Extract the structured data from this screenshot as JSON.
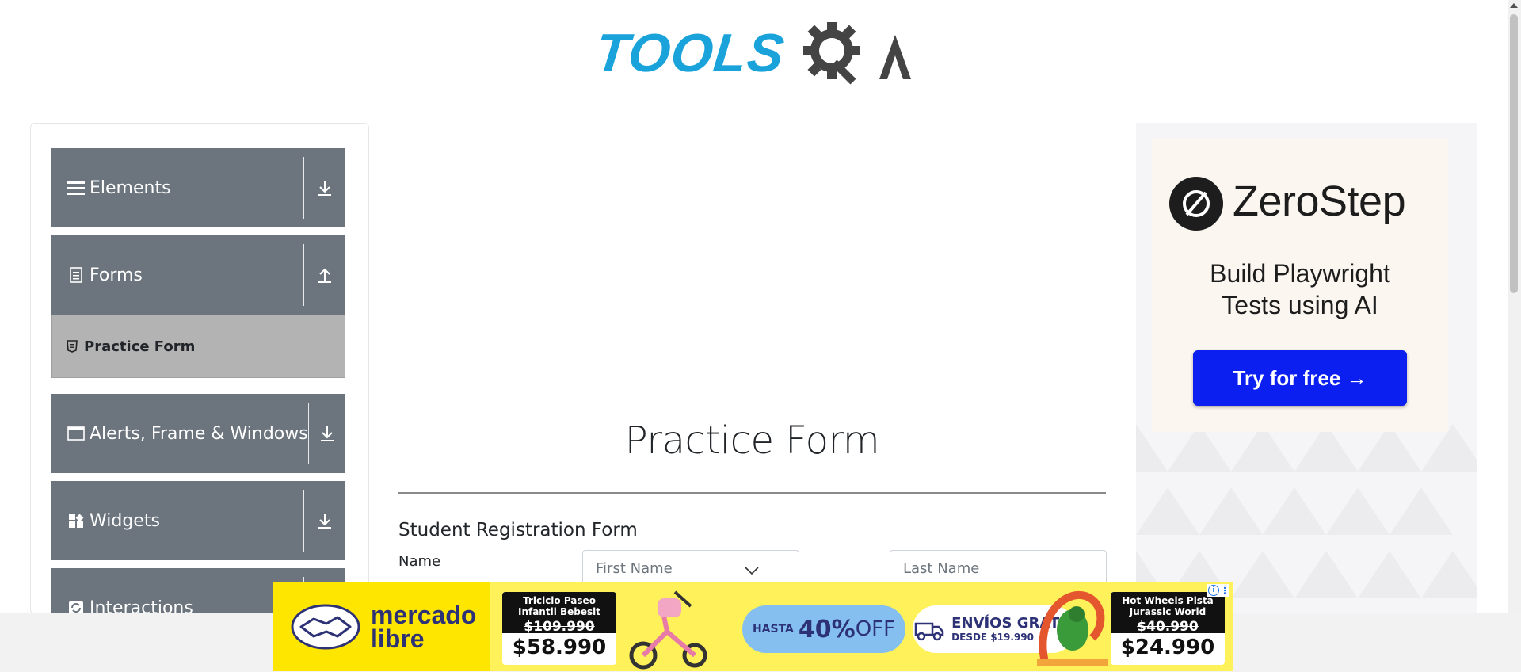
{
  "logo": {
    "part1": "TOOLS",
    "part2": "QA"
  },
  "sidebar": {
    "groups": [
      {
        "label": "Elements",
        "icon": "hamburger-icon",
        "toggle": "download-arrow-icon"
      },
      {
        "label": "Forms",
        "icon": "document-icon",
        "toggle": "upload-arrow-icon"
      },
      {
        "label": "Alerts, Frame & Windows",
        "icon": "window-icon",
        "toggle": "download-arrow-icon"
      },
      {
        "label": "Widgets",
        "icon": "widgets-icon",
        "toggle": "download-arrow-icon"
      },
      {
        "label": "Interactions",
        "icon": "refresh-icon",
        "toggle": "download-arrow-icon"
      }
    ],
    "active_item": {
      "label": "Practice Form",
      "icon": "html5-icon"
    }
  },
  "main": {
    "page_title": "Practice Form",
    "form_title": "Student Registration Form",
    "name_label": "Name",
    "first_name_placeholder": "First Name",
    "last_name_placeholder": "Last Name"
  },
  "ad_right": {
    "brand": "ZeroStep",
    "tagline_line1": "Build Playwright",
    "tagline_line2": "Tests using AI",
    "cta": "Try for free →"
  },
  "ad_bottom": {
    "brand_line1": "mercado",
    "brand_line2": "libre",
    "product1": {
      "title": "Triciclo Paseo Infantil Bebesit",
      "old_price": "$109.990",
      "price": "$58.990"
    },
    "promo1": {
      "prefix": "HASTA",
      "value": "40%",
      "suffix": "OFF"
    },
    "promo2": {
      "title": "ENVÍOS GRATIS",
      "subtitle": "DESDE $19.990"
    },
    "product2": {
      "title": "Hot Wheels Pista Jurassic World",
      "old_price": "$40.990",
      "price": "$24.990"
    },
    "adchoices": "i"
  },
  "colors": {
    "sidebar_group": "#6c757d",
    "sidebar_active": "#b3b3b3",
    "logo_blue": "#1aa3db",
    "zerostep_button": "#0a1ff0",
    "mercadolibre_yellow": "#ffe600"
  }
}
